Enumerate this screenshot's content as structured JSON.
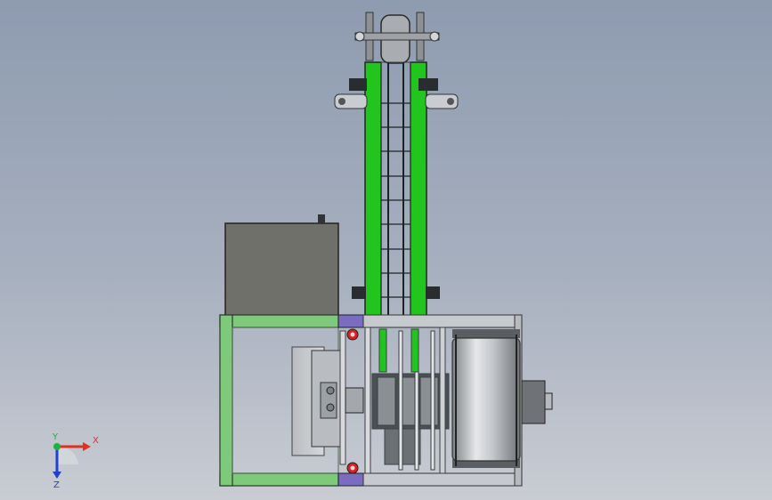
{
  "triad": {
    "x_label": "X",
    "y_label": "Y",
    "z_label": "Z",
    "x_color": "#e03020",
    "y_color": "#20b040",
    "z_color": "#2040d0"
  },
  "colors": {
    "frame_green": "#7fc97a",
    "belt_green": "#22c51e",
    "purple_block": "#7a6cc0",
    "motor_box": "#6e7069",
    "roller": "#c9ccd0"
  }
}
